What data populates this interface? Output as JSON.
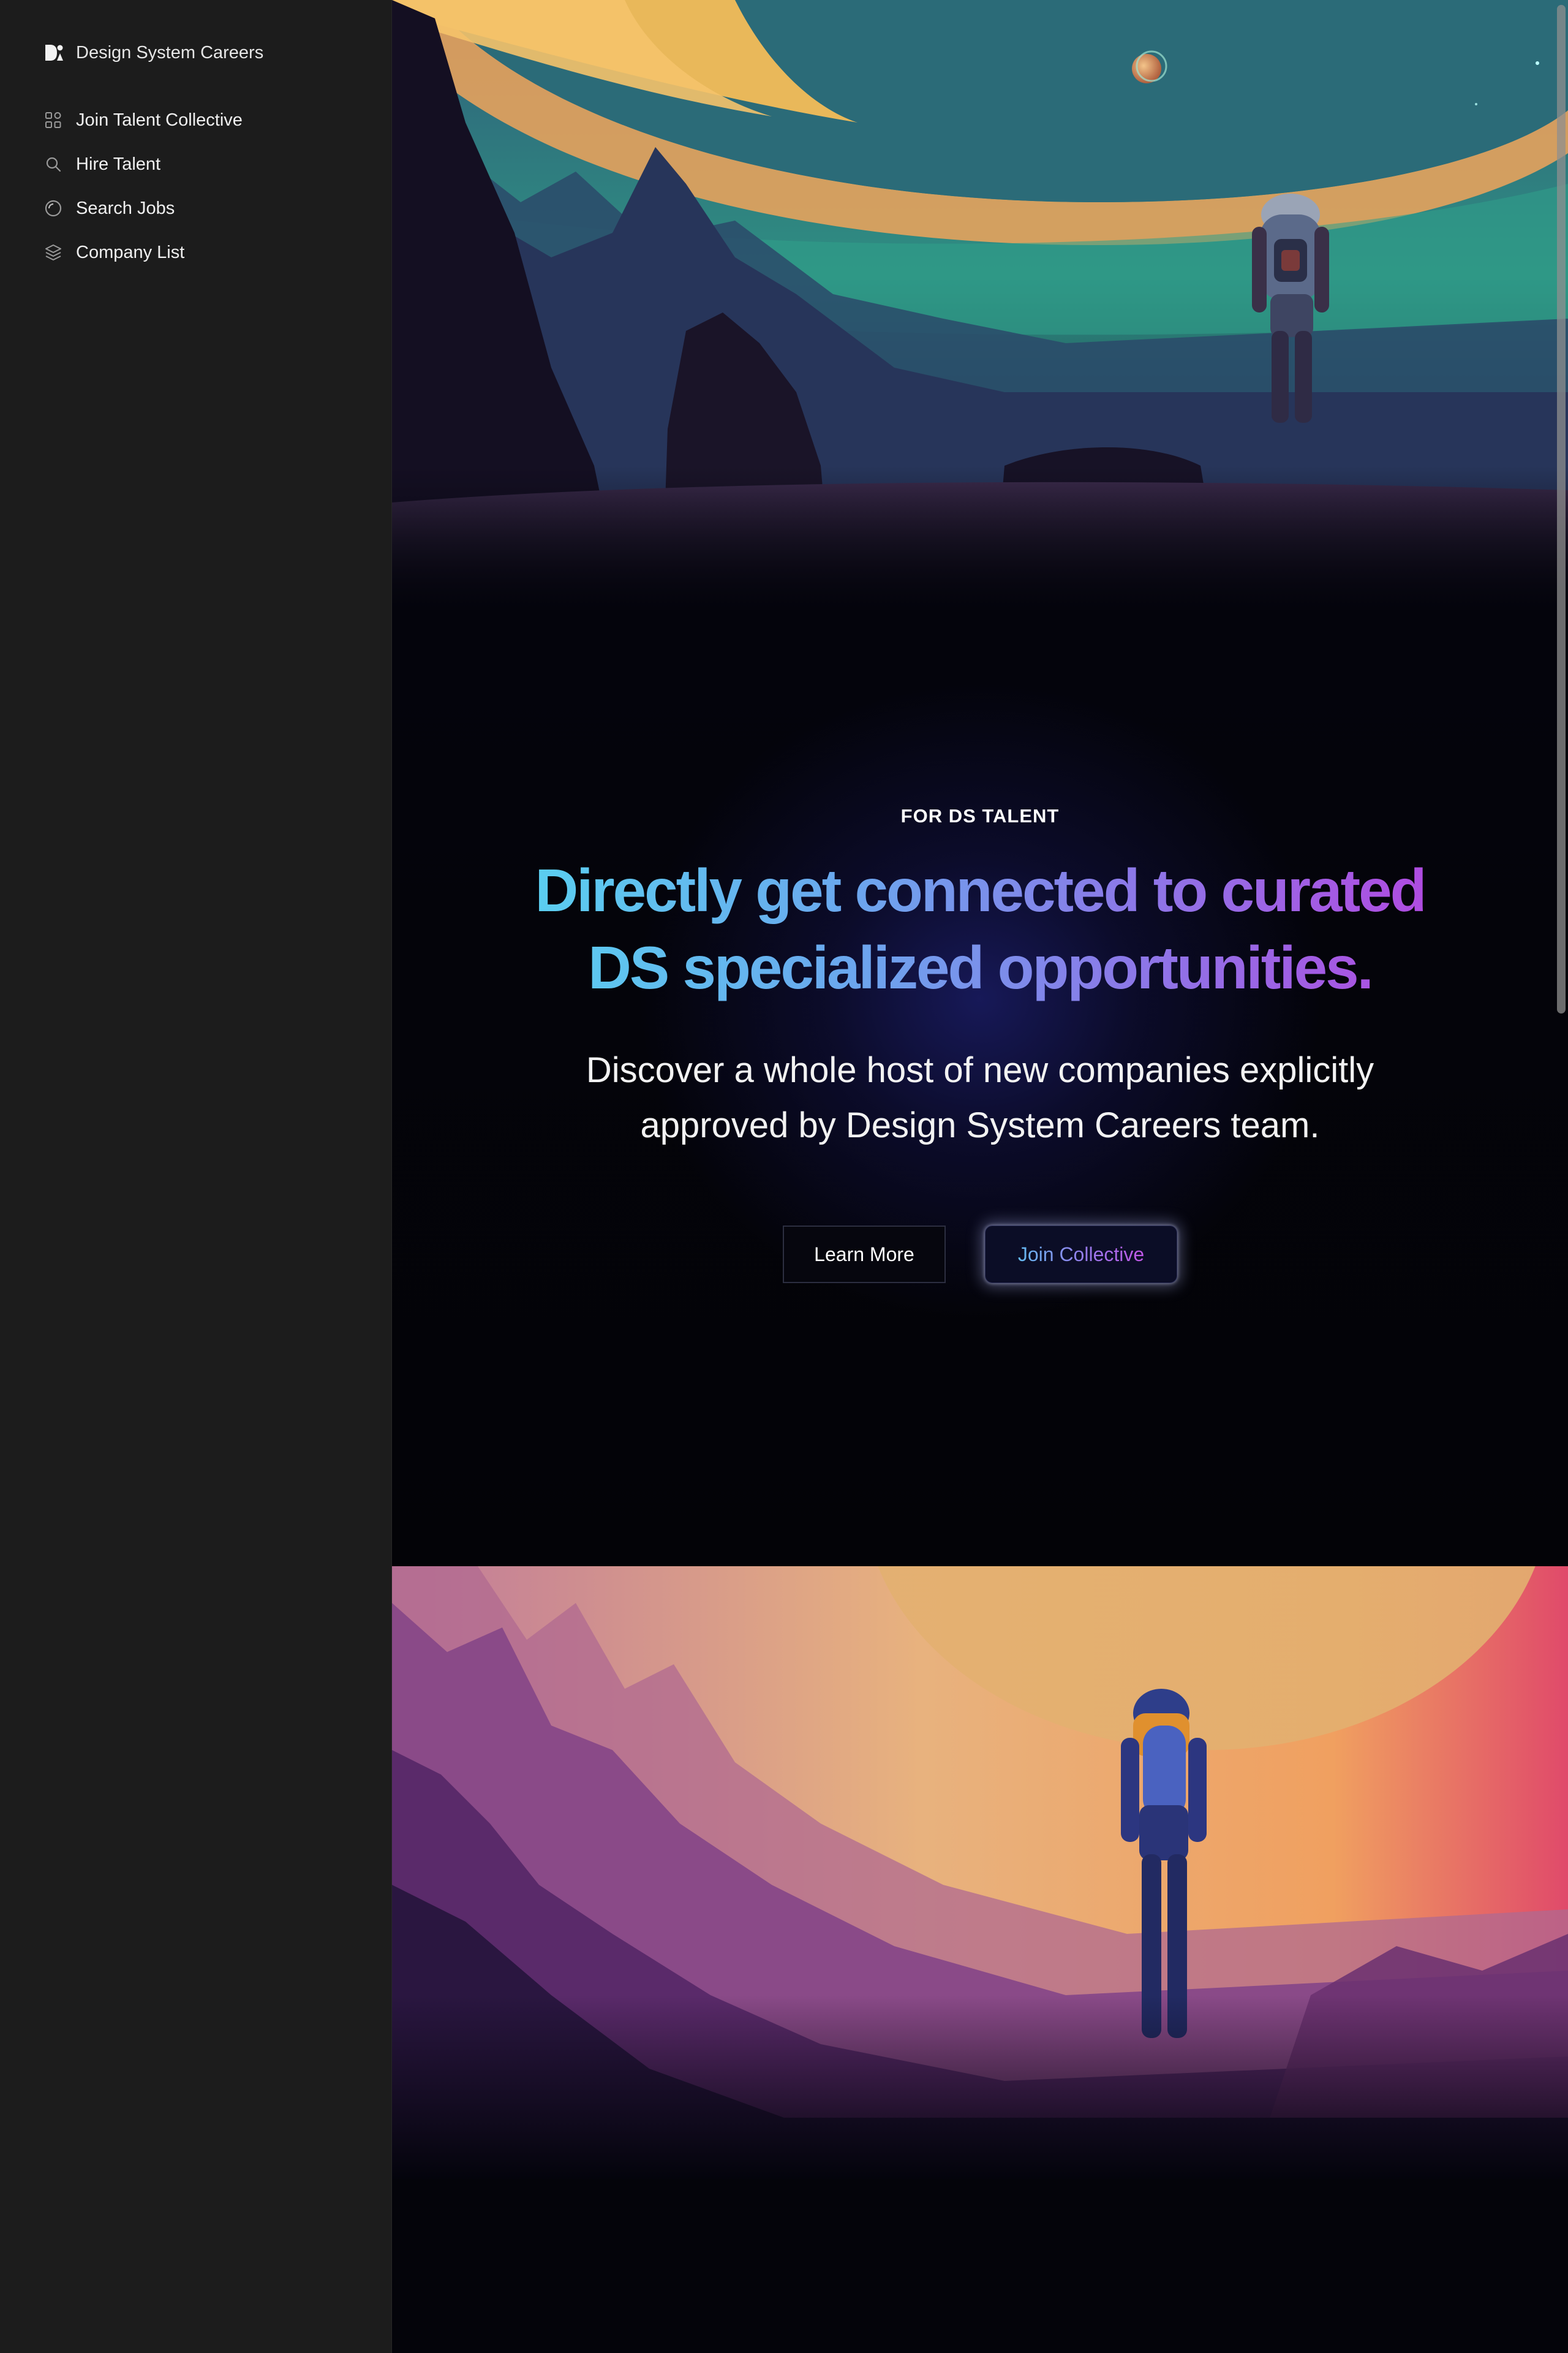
{
  "brand": {
    "name": "Design System Careers",
    "logo_icon": "ds-logo-icon"
  },
  "sidebar": {
    "items": [
      {
        "label": "Join Talent Collective",
        "icon": "grid-icon"
      },
      {
        "label": "Hire Talent",
        "icon": "search-icon"
      },
      {
        "label": "Search Jobs",
        "icon": "circle-icon"
      },
      {
        "label": "Company List",
        "icon": "layers-icon"
      }
    ]
  },
  "hero": {
    "eyebrow": "FOR DS TALENT",
    "headline": "Directly get connected to curated DS specialized opportunities.",
    "subcopy": "Discover a whole host of new companies explicitly approved by Design System Careers team.",
    "learn_more_label": "Learn More",
    "join_label": "Join Collective"
  },
  "images": {
    "top": "astronaut-on-alien-planet-illustration",
    "bottom": "astronaut-in-pink-mountain-valley-illustration"
  },
  "colors": {
    "sidebar_bg": "#1c1c1c",
    "page_bg": "#04040a",
    "gradient_start": "#5ad0f0",
    "gradient_end": "#b14ae0"
  }
}
